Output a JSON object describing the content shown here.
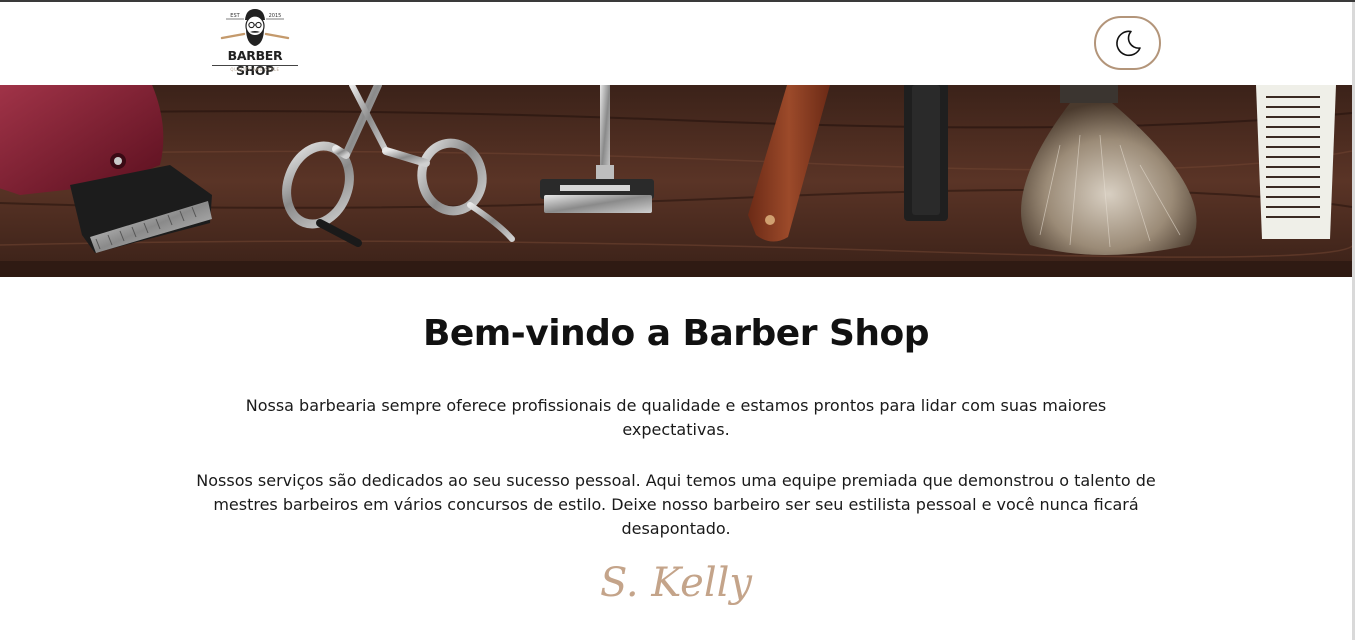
{
  "header": {
    "logo": {
      "brand": "BARBER SHOP",
      "tagline": "QUALITY AND STYLE",
      "year_left": "EST",
      "year_right": "2015"
    },
    "theme_toggle_icon": "moon-icon"
  },
  "hero": {
    "image_subject": "barber tools on wooden table",
    "icons": [
      "clipper-icon",
      "scissors-icon",
      "razor-icon",
      "straight-razor-icon",
      "trimmer-icon",
      "shaving-brush-icon",
      "comb-icon"
    ]
  },
  "main": {
    "title": "Bem-vindo a Barber Shop",
    "paragraphs": [
      "Nossa barbearia sempre oferece profissionais de qualidade e estamos prontos para lidar com suas maiores expectativas.",
      "Nossos serviços são dedicados ao seu sucesso pessoal. Aqui temos uma equipe premiada que demonstrou o talento de mestres barbeiros em vários concursos de estilo. Deixe nosso barbeiro ser seu estilista pessoal e você nunca ficará desapontado."
    ],
    "signature": "S. Kelly"
  },
  "colors": {
    "accent": "#b3957a",
    "signature": "#c4a48a",
    "wood": "#4a2a1e"
  }
}
